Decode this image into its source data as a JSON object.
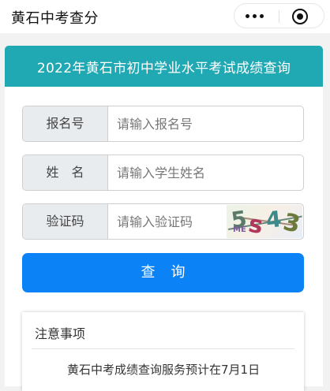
{
  "nav": {
    "title": "黄石中考查分",
    "more_icon": "more-dots-icon",
    "close_icon": "close-circle-icon"
  },
  "banner": {
    "title": "2022年黄石市初中学业水平考试成绩查询",
    "color": "#20a8b3"
  },
  "form": {
    "fields": [
      {
        "label": "报名号",
        "placeholder": "请输入报名号"
      },
      {
        "label": "姓　名",
        "placeholder": "请输入学生姓名"
      },
      {
        "label": "验证码",
        "placeholder": "请输入验证码"
      }
    ],
    "captcha": {
      "text": "5s43"
    },
    "query_button": "查询",
    "button_color": "#0b82f6"
  },
  "notice": {
    "title": "注意事项",
    "text": "黄石中考成绩查询服务预计在7月1日"
  }
}
